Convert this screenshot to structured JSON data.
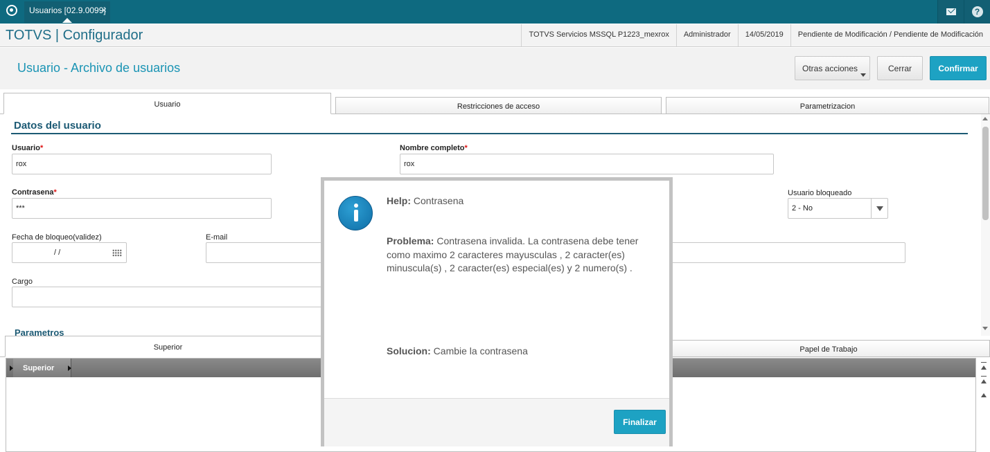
{
  "topbar": {
    "tab_label": "Usuarios [02.9.0099]",
    "tab_close": "×",
    "help_glyph": "?"
  },
  "header": {
    "brand": "TOTVS | Configurador",
    "info": [
      "TOTVS Servicios MSSQL P1223_mexrox",
      "Administrador",
      "14/05/2019",
      "Pendiente de Modificación / Pendiente de Modificación"
    ]
  },
  "page": {
    "title": "Usuario - Archivo de usuarios",
    "buttons": {
      "more": "Otras acciones",
      "close": "Cerrar",
      "confirm": "Confirmar"
    }
  },
  "tabs": [
    "Usuario",
    "Restricciones de acceso",
    "Parametrizacion"
  ],
  "form": {
    "section_title": "Datos del usuario",
    "required_mark": "*",
    "usuario": {
      "label": "Usuario",
      "value": "rox"
    },
    "nombre": {
      "label": "Nombre completo",
      "value": "rox"
    },
    "contrasena": {
      "label": "Contrasena",
      "value": "***"
    },
    "bloqueado": {
      "label": "Usuario bloqueado",
      "value": "2 - No"
    },
    "fecha": {
      "label": "Fecha de bloqueo(validez)",
      "value": "/ /"
    },
    "email": {
      "label": "E-mail",
      "value": ""
    },
    "cargo": {
      "label": "Cargo",
      "value": ""
    },
    "section2": "Parametros"
  },
  "lower_tabs": [
    "Superior",
    "Papel de Trabajo"
  ],
  "grid": {
    "header": "Superior"
  },
  "modal": {
    "help_label": "Help:",
    "help_value": "Contrasena",
    "problem_label": "Problema:",
    "problem_text": "Contrasena invalida. La contrasena debe tener como maximo 2 caracteres mayusculas , 2 caracter(es) minuscula(s) , 2 caracter(es) especial(es) y 2 numero(s) .",
    "solution_label": "Solucion:",
    "solution_text": "Cambie la contrasena",
    "button": "Finalizar"
  },
  "colors": {
    "topbar": "#0e6a80",
    "accent": "#1da2c3",
    "section": "#1c5a74",
    "required": "#dd1111"
  }
}
